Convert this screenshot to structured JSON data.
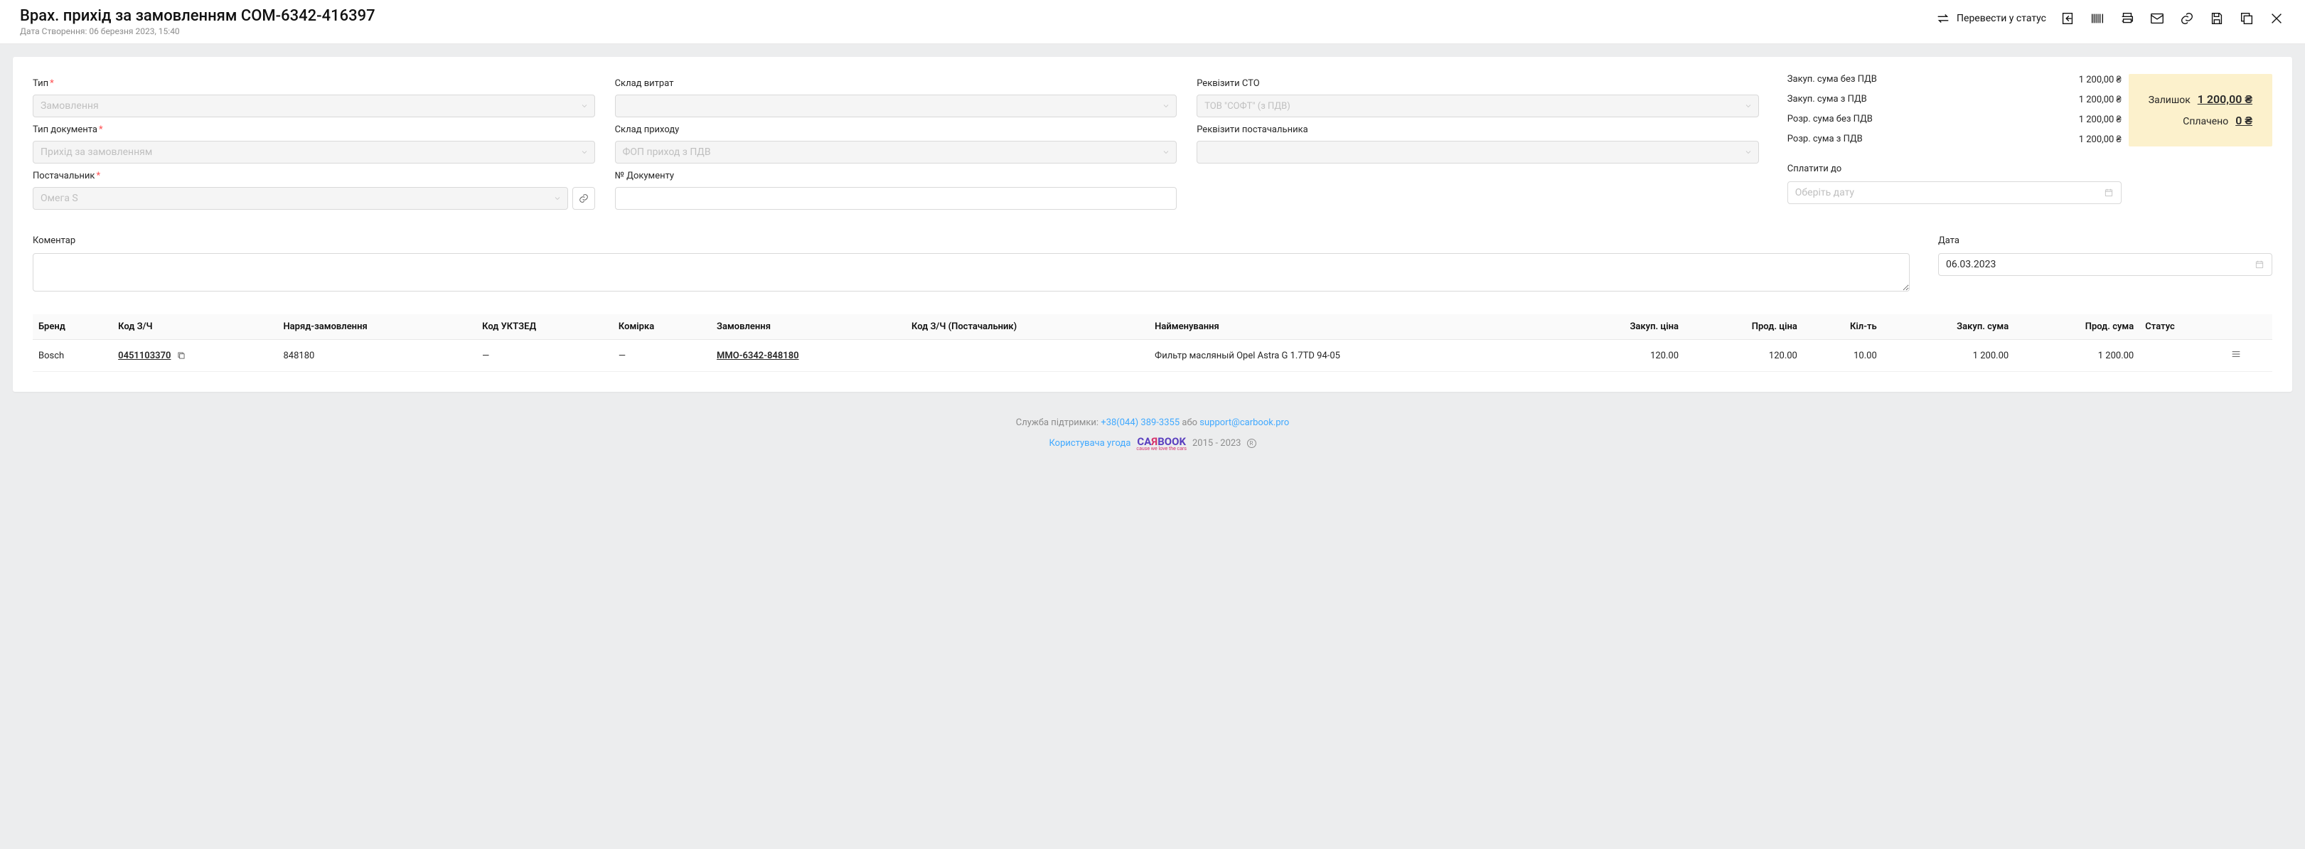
{
  "header": {
    "title": "Врах. прихід за замовленням COM-6342-416397",
    "created_label": "Дата Створення: 06 березня 2023, 15:40",
    "status_label": "Перевести у статус"
  },
  "form": {
    "col1": {
      "type_label": "Тип",
      "type_value": "Замовлення",
      "doctype_label": "Тип документа",
      "doctype_value": "Прихід за замовленням",
      "supplier_label": "Постачальник",
      "supplier_value": "Омега S"
    },
    "col2": {
      "wh_out_label": "Склад витрат",
      "wh_in_label": "Склад приходу",
      "wh_in_value": "ФОП приход з ПДВ",
      "docnum_label": "№ Документу"
    },
    "col3": {
      "sto_label": "Реквізити СТО",
      "sto_value": "ТОВ \"СОФТ\"   (з ПДВ)",
      "supplier_req_label": "Реквізити постачальника"
    }
  },
  "totals": {
    "rows": [
      {
        "label": "Закуп. сума без ПДВ",
        "value": "1 200,00 ₴"
      },
      {
        "label": "Закуп. сума з ПДВ",
        "value": "1 200,00 ₴"
      },
      {
        "label": "Розр. сума без ПДВ",
        "value": "1 200,00 ₴"
      },
      {
        "label": "Розр. сума з ПДВ",
        "value": "1 200,00 ₴"
      }
    ],
    "remain_label": "Залишок",
    "remain_value": "1 200,00 ₴",
    "paid_label": "Сплачено",
    "paid_value": "0 ₴",
    "payby_label": "Сплатити до",
    "payby_placeholder": "Оберіть дату"
  },
  "second": {
    "comment_label": "Коментар",
    "date_label": "Дата",
    "date_value": "06.03.2023"
  },
  "table": {
    "headers": {
      "brand": "Бренд",
      "partcode": "Код З/Ч",
      "order_doc": "Наряд-замовлення",
      "uktzed": "Код УКТЗЕД",
      "cell": "Комірка",
      "order": "Замовлення",
      "supplier_code": "Код З/Ч (Постачальник)",
      "name": "Найменування",
      "pur_price": "Закуп. ціна",
      "sale_price": "Прод. ціна",
      "qty": "Кіл-ть",
      "pur_sum": "Закуп. сума",
      "sale_sum": "Прод. сума",
      "status": "Статус"
    },
    "rows": [
      {
        "brand": "Bosch",
        "partcode": "0451103370",
        "order_doc": "848180",
        "uktzed": "—",
        "cell": "—",
        "order": "MMO-6342-848180",
        "supplier_code": "",
        "name": "Фильтр масляный Opel Astra G 1.7TD 94-05",
        "pur_price": "120.00",
        "sale_price": "120.00",
        "qty": "10.00",
        "pur_sum": "1 200.00",
        "sale_sum": "1 200.00"
      }
    ]
  },
  "footer": {
    "support_label": "Служба підтримки: ",
    "phone": "+38(044) 389-3355",
    "or": " або ",
    "email": "support@carbook.pro",
    "agreement": "Користувача угода",
    "years": "2015 - 2023"
  }
}
